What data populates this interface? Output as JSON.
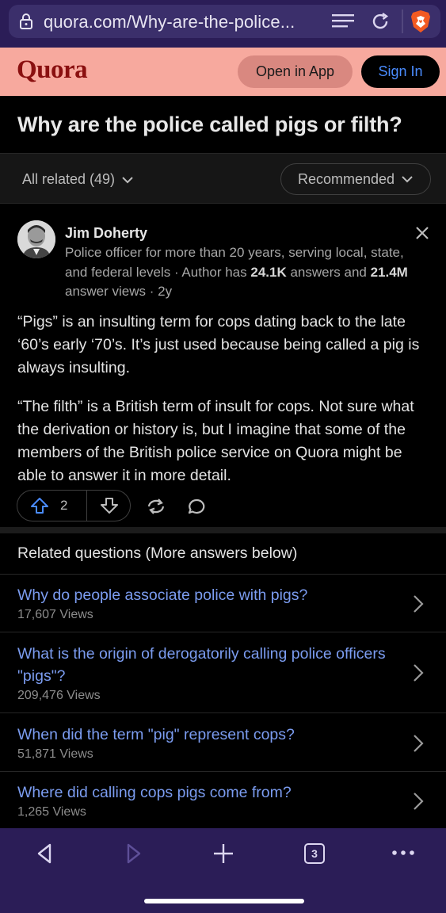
{
  "browser": {
    "url": "quora.com/Why-are-the-police...",
    "tab_count": "3",
    "icons": [
      "lock-icon",
      "reader-mode-icon",
      "reload-icon",
      "brave-shield-icon",
      "back-icon",
      "forward-icon",
      "new-tab-icon",
      "tabs-icon",
      "more-menu-icon"
    ]
  },
  "header": {
    "logo": "Quora",
    "open_app": "Open in App",
    "sign_in": "Sign In"
  },
  "question": {
    "title": "Why are the police called pigs or filth?"
  },
  "filters": {
    "all_related": "All related (49)",
    "sort": "Recommended"
  },
  "answer": {
    "author": "Jim Doherty",
    "credential_text": "Police officer for more than 20 years, serving local, state, and federal levels · Author has ",
    "answers_count": "24.1K",
    "answers_label": " answers and ",
    "views_count": "21.4M",
    "views_label": " answer views · 2y",
    "paragraph1": "“Pigs” is an insulting term for cops dating back to the late ‘60’s early ‘70’s. It’s just used because being called a pig is always insulting.",
    "paragraph2": "“The filth” is a British term of insult for cops. Not sure what the derivation or history is, but I imagine that some of the members of the British police service on Quora might be able to answer it in more detail.",
    "upvotes": "2"
  },
  "related": {
    "heading": "Related questions (More answers below)",
    "items": [
      {
        "question": "Why do people associate police with pigs?",
        "views": "17,607 Views"
      },
      {
        "question": "What is the origin of derogatorily calling police officers \"pigs\"?",
        "views": "209,476 Views"
      },
      {
        "question": "When did the term \"pig\" represent cops?",
        "views": "51,871 Views"
      },
      {
        "question": "Where did calling cops pigs come from?",
        "views": "1,265 Views"
      }
    ]
  },
  "colors": {
    "header_bg": "#f7a99e",
    "logo": "#8a1010",
    "link": "#7b9cf0",
    "browser_chrome": "#2b1d57",
    "upvote_blue": "#4a8cff"
  }
}
